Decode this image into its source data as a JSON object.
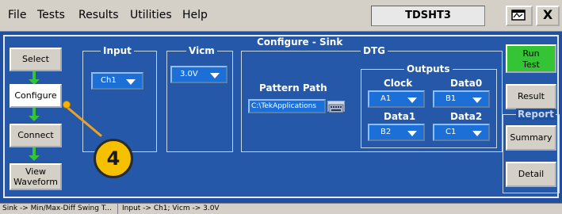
{
  "menu": {
    "items": [
      "File",
      "Tests",
      "Results",
      "Utilities",
      "Help"
    ]
  },
  "app": {
    "name": "TDSHT3",
    "close_label": "X"
  },
  "panel": {
    "title": "Configure - Sink"
  },
  "workflow": {
    "select": "Select",
    "configure": "Configure",
    "connect": "Connect",
    "view_line1": "View",
    "view_line2": "Waveform"
  },
  "input": {
    "title": "Input",
    "value": "Ch1"
  },
  "vicm": {
    "title": "Vicm",
    "value": "3.0V"
  },
  "dtg": {
    "title": "DTG",
    "pattern_path_label": "Pattern Path",
    "pattern_path_value": "C:\\TekApplications",
    "outputs_title": "Outputs",
    "clock_label": "Clock",
    "clock_value": "A1",
    "data0_label": "Data0",
    "data0_value": "B1",
    "data1_label": "Data1",
    "data1_value": "B2",
    "data2_label": "Data2",
    "data2_value": "C1"
  },
  "right": {
    "run_line1": "Run",
    "run_line2": "Test",
    "result": "Result",
    "report_title": "Report",
    "summary": "Summary",
    "detail": "Detail"
  },
  "status": {
    "left": "Sink -> Min/Max-Diff Swing T...",
    "right": "Input -> Ch1; Vicm -> 3.0V"
  },
  "callout": {
    "number": "4"
  },
  "colors": {
    "panel_bg": "#2558a8",
    "dropdown": "#1d6fd8",
    "run_green": "#35c435",
    "callout": "#f5c000"
  }
}
